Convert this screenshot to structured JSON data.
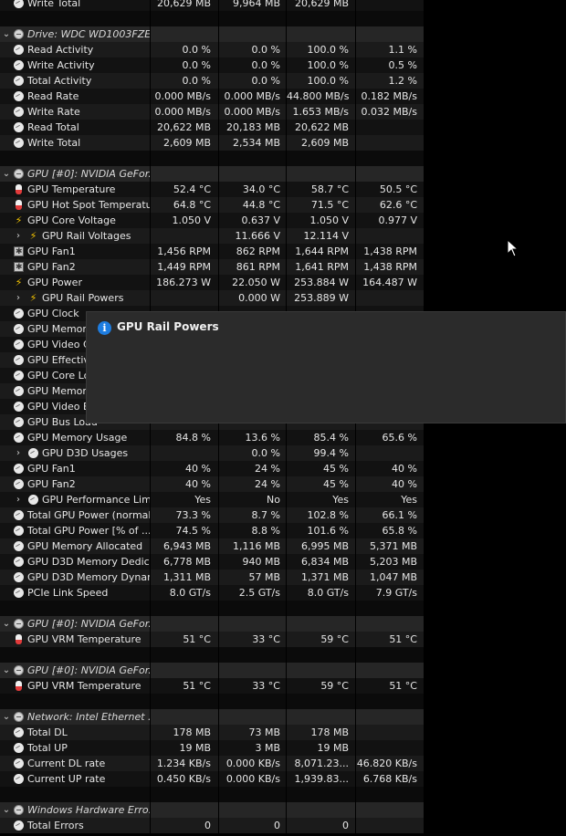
{
  "rows": [
    {
      "type": "sensor",
      "icon": "sensor",
      "label": "Write Total",
      "v": [
        "20,629 MB",
        "9,964 MB",
        "20,629 MB",
        ""
      ]
    },
    {
      "type": "blank"
    },
    {
      "type": "group",
      "icon": "drive",
      "label": "Drive: WDC WD1003FZE..."
    },
    {
      "type": "sensor",
      "icon": "sensor",
      "label": "Read Activity",
      "v": [
        "0.0 %",
        "0.0 %",
        "100.0 %",
        "1.1 %"
      ]
    },
    {
      "type": "sensor",
      "icon": "sensor",
      "label": "Write Activity",
      "v": [
        "0.0 %",
        "0.0 %",
        "100.0 %",
        "0.5 %"
      ]
    },
    {
      "type": "sensor",
      "icon": "sensor",
      "label": "Total Activity",
      "v": [
        "0.0 %",
        "0.0 %",
        "100.0 %",
        "1.2 %"
      ]
    },
    {
      "type": "sensor",
      "icon": "sensor",
      "label": "Read Rate",
      "v": [
        "0.000 MB/s",
        "0.000 MB/s",
        "44.800 MB/s",
        "0.182 MB/s"
      ]
    },
    {
      "type": "sensor",
      "icon": "sensor",
      "label": "Write Rate",
      "v": [
        "0.000 MB/s",
        "0.000 MB/s",
        "1.653 MB/s",
        "0.032 MB/s"
      ]
    },
    {
      "type": "sensor",
      "icon": "sensor",
      "label": "Read Total",
      "v": [
        "20,622 MB",
        "20,183 MB",
        "20,622 MB",
        ""
      ]
    },
    {
      "type": "sensor",
      "icon": "sensor",
      "label": "Write Total",
      "v": [
        "2,609 MB",
        "2,534 MB",
        "2,609 MB",
        ""
      ]
    },
    {
      "type": "blank"
    },
    {
      "type": "group",
      "icon": "drive",
      "label": "GPU [#0]: NVIDIA GeFor..."
    },
    {
      "type": "sensor",
      "icon": "thermo",
      "label": "GPU Temperature",
      "v": [
        "52.4 °C",
        "34.0 °C",
        "58.7 °C",
        "50.5 °C"
      ]
    },
    {
      "type": "sensor",
      "icon": "thermo",
      "label": "GPU Hot Spot Temperature",
      "v": [
        "64.8 °C",
        "44.8 °C",
        "71.5 °C",
        "62.6 °C"
      ]
    },
    {
      "type": "sensor",
      "icon": "bolt",
      "label": "GPU Core Voltage",
      "v": [
        "1.050 V",
        "0.637 V",
        "1.050 V",
        "0.977 V"
      ]
    },
    {
      "type": "sensor",
      "icon": "bolt",
      "label": "GPU Rail Voltages",
      "indent": true,
      "expand": true,
      "v": [
        "",
        "11.666 V",
        "12.114 V",
        ""
      ]
    },
    {
      "type": "sensor",
      "icon": "fan",
      "label": "GPU Fan1",
      "v": [
        "1,456 RPM",
        "862 RPM",
        "1,644 RPM",
        "1,438 RPM"
      ]
    },
    {
      "type": "sensor",
      "icon": "fan",
      "label": "GPU Fan2",
      "v": [
        "1,449 RPM",
        "861 RPM",
        "1,641 RPM",
        "1,438 RPM"
      ]
    },
    {
      "type": "sensor",
      "icon": "bolt",
      "label": "GPU Power",
      "v": [
        "186.273 W",
        "22.050 W",
        "253.884 W",
        "164.487 W"
      ]
    },
    {
      "type": "sensor",
      "icon": "bolt",
      "label": "GPU Rail Powers",
      "indent": true,
      "expand": true,
      "v": [
        "",
        "0.000 W",
        "253.889 W",
        ""
      ]
    },
    {
      "type": "sensor",
      "icon": "sensor",
      "label": "GPU Clock",
      "v": [
        "",
        "",
        "",
        ""
      ]
    },
    {
      "type": "sensor",
      "icon": "sensor",
      "label": "GPU Memory",
      "v": [
        "",
        "",
        "",
        ""
      ]
    },
    {
      "type": "sensor",
      "icon": "sensor",
      "label": "GPU Video Clo",
      "v": [
        "",
        "",
        "",
        ""
      ]
    },
    {
      "type": "sensor",
      "icon": "sensor",
      "label": "GPU Effective",
      "v": [
        "",
        "",
        "",
        ""
      ]
    },
    {
      "type": "sensor",
      "icon": "sensor",
      "label": "GPU Core Loa",
      "v": [
        "",
        "",
        "",
        ""
      ]
    },
    {
      "type": "sensor",
      "icon": "sensor",
      "label": "GPU Memory",
      "v": [
        "",
        "",
        "",
        ""
      ]
    },
    {
      "type": "sensor",
      "icon": "sensor",
      "label": "GPU Video En",
      "v": [
        "",
        "",
        "",
        ""
      ]
    },
    {
      "type": "sensor",
      "icon": "sensor",
      "label": "GPU Bus Load",
      "v": [
        "",
        "",
        "",
        ""
      ]
    },
    {
      "type": "sensor",
      "icon": "sensor",
      "label": "GPU Memory Usage",
      "v": [
        "84.8 %",
        "13.6 %",
        "85.4 %",
        "65.6 %"
      ]
    },
    {
      "type": "sensor",
      "icon": "sensor",
      "label": "GPU D3D Usages",
      "indent": true,
      "expand": true,
      "v": [
        "",
        "0.0 %",
        "99.4 %",
        ""
      ]
    },
    {
      "type": "sensor",
      "icon": "sensor",
      "label": "GPU Fan1",
      "v": [
        "40 %",
        "24 %",
        "45 %",
        "40 %"
      ]
    },
    {
      "type": "sensor",
      "icon": "sensor",
      "label": "GPU Fan2",
      "v": [
        "40 %",
        "24 %",
        "45 %",
        "40 %"
      ]
    },
    {
      "type": "sensor",
      "icon": "sensor",
      "label": "GPU Performance Limits",
      "indent": true,
      "expand": true,
      "v": [
        "Yes",
        "No",
        "Yes",
        "Yes"
      ]
    },
    {
      "type": "sensor",
      "icon": "sensor",
      "label": "Total GPU Power (normal...",
      "v": [
        "73.3 %",
        "8.7 %",
        "102.8 %",
        "66.1 %"
      ]
    },
    {
      "type": "sensor",
      "icon": "sensor",
      "label": "Total GPU Power [% of ...",
      "v": [
        "74.5 %",
        "8.8 %",
        "101.6 %",
        "65.8 %"
      ]
    },
    {
      "type": "sensor",
      "icon": "sensor",
      "label": "GPU Memory Allocated",
      "v": [
        "6,943 MB",
        "1,116 MB",
        "6,995 MB",
        "5,371 MB"
      ]
    },
    {
      "type": "sensor",
      "icon": "sensor",
      "label": "GPU D3D Memory Dedica...",
      "v": [
        "6,778 MB",
        "940 MB",
        "6,834 MB",
        "5,203 MB"
      ]
    },
    {
      "type": "sensor",
      "icon": "sensor",
      "label": "GPU D3D Memory Dynamic",
      "v": [
        "1,311 MB",
        "57 MB",
        "1,371 MB",
        "1,047 MB"
      ]
    },
    {
      "type": "sensor",
      "icon": "sensor",
      "label": "PCIe Link Speed",
      "v": [
        "8.0 GT/s",
        "2.5 GT/s",
        "8.0 GT/s",
        "7.9 GT/s"
      ]
    },
    {
      "type": "blank"
    },
    {
      "type": "group",
      "icon": "drive",
      "label": "GPU [#0]: NVIDIA GeFor..."
    },
    {
      "type": "sensor",
      "icon": "thermo",
      "label": "GPU VRM Temperature",
      "v": [
        "51 °C",
        "33 °C",
        "59 °C",
        "51 °C"
      ]
    },
    {
      "type": "blank"
    },
    {
      "type": "group",
      "icon": "drive",
      "label": "GPU [#0]: NVIDIA GeFor..."
    },
    {
      "type": "sensor",
      "icon": "thermo",
      "label": "GPU VRM Temperature",
      "v": [
        "51 °C",
        "33 °C",
        "59 °C",
        "51 °C"
      ]
    },
    {
      "type": "blank"
    },
    {
      "type": "group",
      "icon": "drive",
      "label": "Network: Intel Ethernet ..."
    },
    {
      "type": "sensor",
      "icon": "sensor",
      "label": "Total DL",
      "v": [
        "178 MB",
        "73 MB",
        "178 MB",
        ""
      ]
    },
    {
      "type": "sensor",
      "icon": "sensor",
      "label": "Total UP",
      "v": [
        "19 MB",
        "3 MB",
        "19 MB",
        ""
      ]
    },
    {
      "type": "sensor",
      "icon": "sensor",
      "label": "Current DL rate",
      "v": [
        "1.234 KB/s",
        "0.000 KB/s",
        "8,071.23...",
        "46.820 KB/s"
      ]
    },
    {
      "type": "sensor",
      "icon": "sensor",
      "label": "Current UP rate",
      "v": [
        "0.450 KB/s",
        "0.000 KB/s",
        "1,939.83...",
        "6.768 KB/s"
      ]
    },
    {
      "type": "blank"
    },
    {
      "type": "group",
      "icon": "drive",
      "label": "Windows Hardware Erro..."
    },
    {
      "type": "sensor",
      "icon": "sensor",
      "label": "Total Errors",
      "v": [
        "0",
        "0",
        "0",
        ""
      ]
    }
  ],
  "tooltip": {
    "icon": "info-icon",
    "title": "GPU Rail Powers"
  }
}
